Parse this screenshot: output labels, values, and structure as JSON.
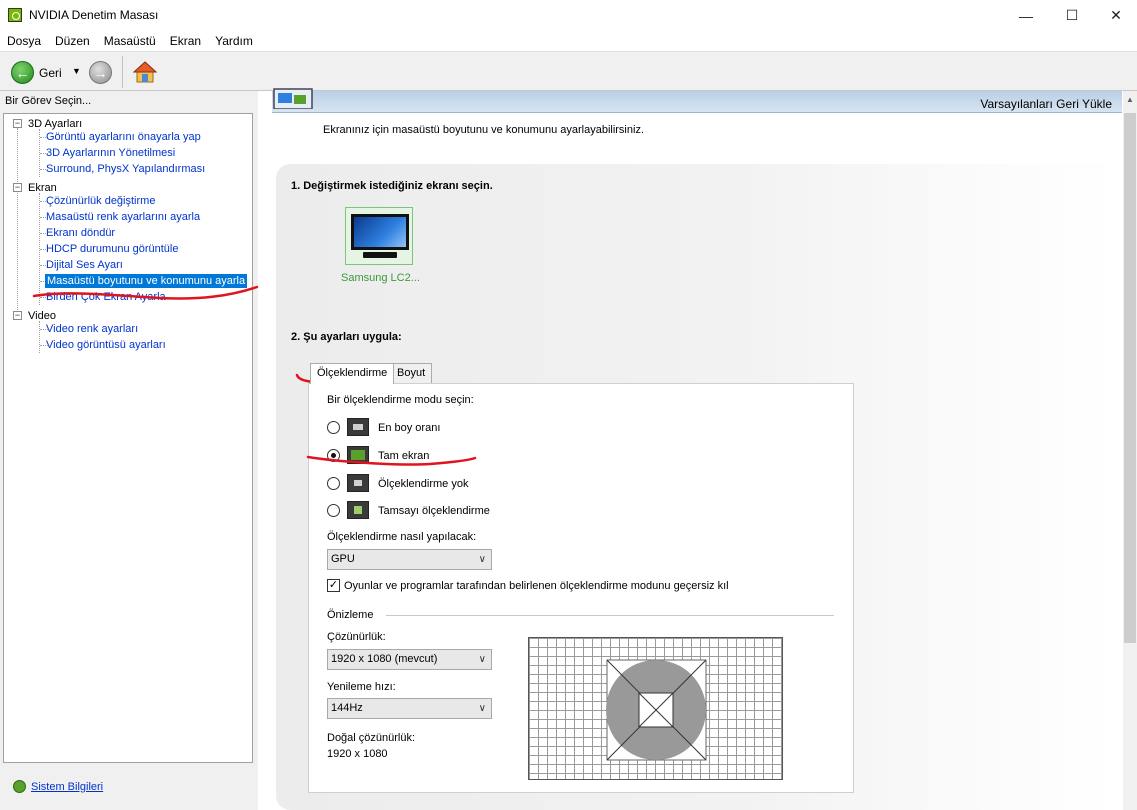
{
  "window": {
    "title": "NVIDIA Denetim Masası"
  },
  "menu": [
    "Dosya",
    "Düzen",
    "Masaüstü",
    "Ekran",
    "Yardım"
  ],
  "toolbar": {
    "back_label": "Geri"
  },
  "sidebar": {
    "header": "Bir Görev Seçin...",
    "groups": [
      {
        "label": "3D Ayarları",
        "items": [
          "Görüntü ayarlarını önayarla yap",
          "3D Ayarlarının Yönetilmesi",
          "Surround, PhysX Yapılandırması"
        ]
      },
      {
        "label": "Ekran",
        "items": [
          "Çözünürlük değiştirme",
          "Masaüstü renk ayarlarını ayarla",
          "Ekranı döndür",
          "HDCP durumunu görüntüle",
          "Dijital Ses Ayarı",
          "Masaüstü boyutunu ve konumunu ayarla",
          "Birden Çok Ekran Ayarla"
        ]
      },
      {
        "label": "Video",
        "items": [
          "Video renk ayarları",
          "Video görüntüsü ayarları"
        ]
      }
    ],
    "selected": "Masaüstü boyutunu ve konumunu ayarla",
    "system_info": "Sistem Bilgileri"
  },
  "main": {
    "restore_defaults": "Varsayılanları Geri Yükle",
    "description": "Ekranınız için masaüstü boyutunu ve konumunu ayarlayabilirsiniz.",
    "step1": "1. Değiştirmek istediğiniz ekranı seçin.",
    "display_name": "Samsung LC2...",
    "step2": "2. Şu ayarları uygula:",
    "tabs": [
      "Ölçeklendirme",
      "Boyut"
    ],
    "active_tab": "Ölçeklendirme",
    "scaling_mode_label": "Bir ölçeklendirme modu seçin:",
    "scaling_modes": [
      {
        "label": "En boy oranı",
        "checked": false
      },
      {
        "label": "Tam ekran",
        "checked": true
      },
      {
        "label": "Ölçeklendirme yok",
        "checked": false
      },
      {
        "label": "Tamsayı ölçeklendirme",
        "checked": false
      }
    ],
    "perform_on_label": "Ölçeklendirme nasıl yapılacak:",
    "perform_on_value": "GPU",
    "override_label": "Oyunlar ve programlar tarafından belirlenen ölçeklendirme modunu geçersiz kıl",
    "override_checked": true,
    "preview_label": "Önizleme",
    "resolution_label": "Çözünürlük:",
    "resolution_value": "1920 x 1080 (mevcut)",
    "refresh_label": "Yenileme hızı:",
    "refresh_value": "144Hz",
    "native_label": "Doğal çözünürlük:",
    "native_value": "1920 x 1080"
  },
  "colors": {
    "selection": "#0078d7",
    "link": "#0033cc",
    "nvidia_green": "#76b900",
    "annotation_red": "#e0141e"
  }
}
